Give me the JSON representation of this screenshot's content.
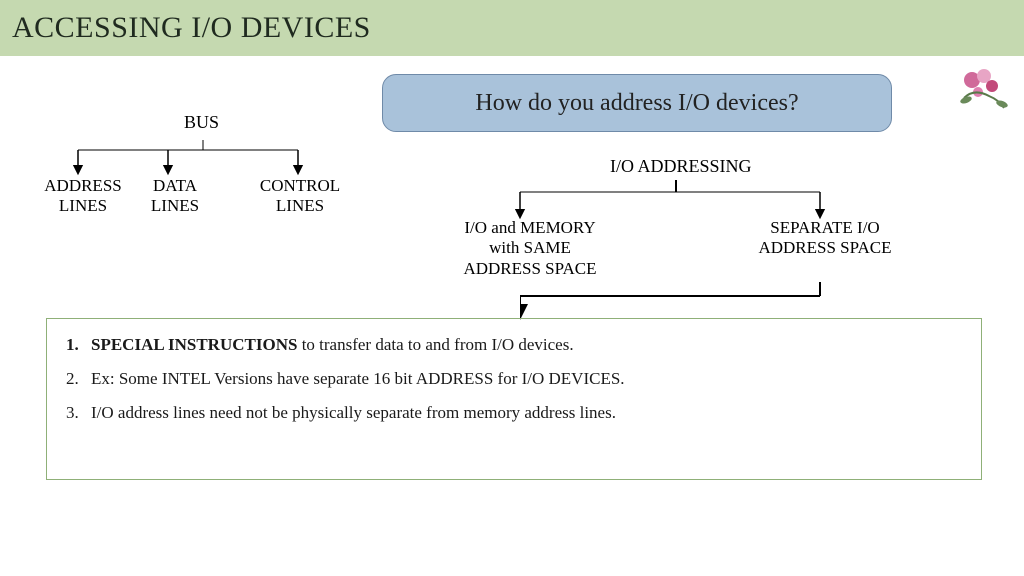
{
  "header": {
    "title": "ACCESSING I/O DEVICES"
  },
  "callout": {
    "text": "How do you address I/O devices?"
  },
  "bus": {
    "root": "BUS",
    "children": [
      "ADDRESS LINES",
      "DATA LINES",
      "CONTROL LINES"
    ]
  },
  "io": {
    "title": "I/O ADDRESSING",
    "left": "I/O and MEMORY with SAME ADDRESS SPACE",
    "right": "SEPARATE I/O ADDRESS SPACE"
  },
  "notes": {
    "item1_bold": "SPECIAL INSTRUCTIONS",
    "item1_rest": " to transfer data to and from I/O devices.",
    "item2": "Ex: Some INTEL Versions have separate 16 bit ADDRESS for I/O DEVICES.",
    "item3": " I/O address lines need not be physically separate from memory address lines."
  }
}
